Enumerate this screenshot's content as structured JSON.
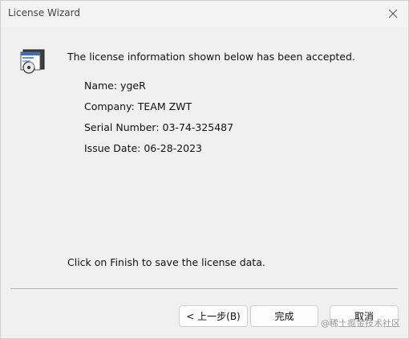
{
  "window": {
    "title": "License Wizard"
  },
  "icons": {
    "close": "close-icon",
    "wizard": "license-wizard-icon"
  },
  "main": {
    "accepted_message": "The license information shown below has been accepted.",
    "name_line": "Name: ygeR",
    "company_line": "Company: TEAM ZWT",
    "serial_line": "Serial Number: 03-74-325487",
    "issue_date_line": "Issue Date: 06-28-2023",
    "finish_message": "Click on Finish to save the license data."
  },
  "buttons": {
    "back_label": "< 上一步(B)",
    "finish_label": "完成",
    "cancel_label": "取消"
  },
  "watermark": "@稀土掘金技术社区"
}
